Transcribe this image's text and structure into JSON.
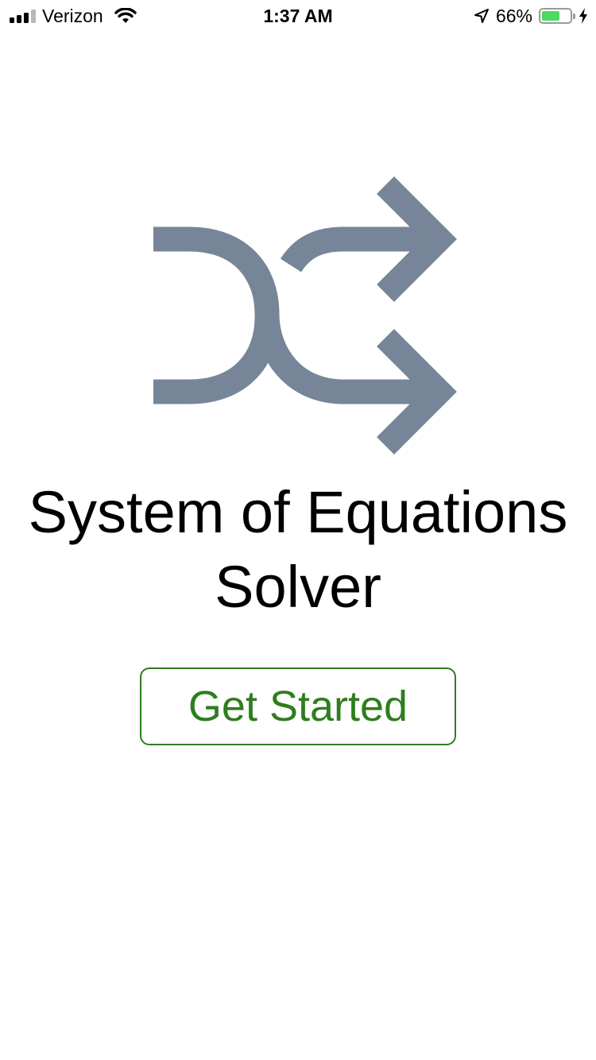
{
  "status_bar": {
    "carrier": "Verizon",
    "time": "1:37 AM",
    "battery_percent_label": "66%",
    "battery_level": 0.66,
    "signal_bars": 3,
    "signal_bars_total": 4
  },
  "main": {
    "icon": "shuffle-icon",
    "title_line1": "System of Equations",
    "title_line2": "Solver",
    "get_started_label": "Get Started"
  },
  "colors": {
    "icon": "#778598",
    "accent": "#2e7d1f",
    "battery": "#4cd964"
  }
}
